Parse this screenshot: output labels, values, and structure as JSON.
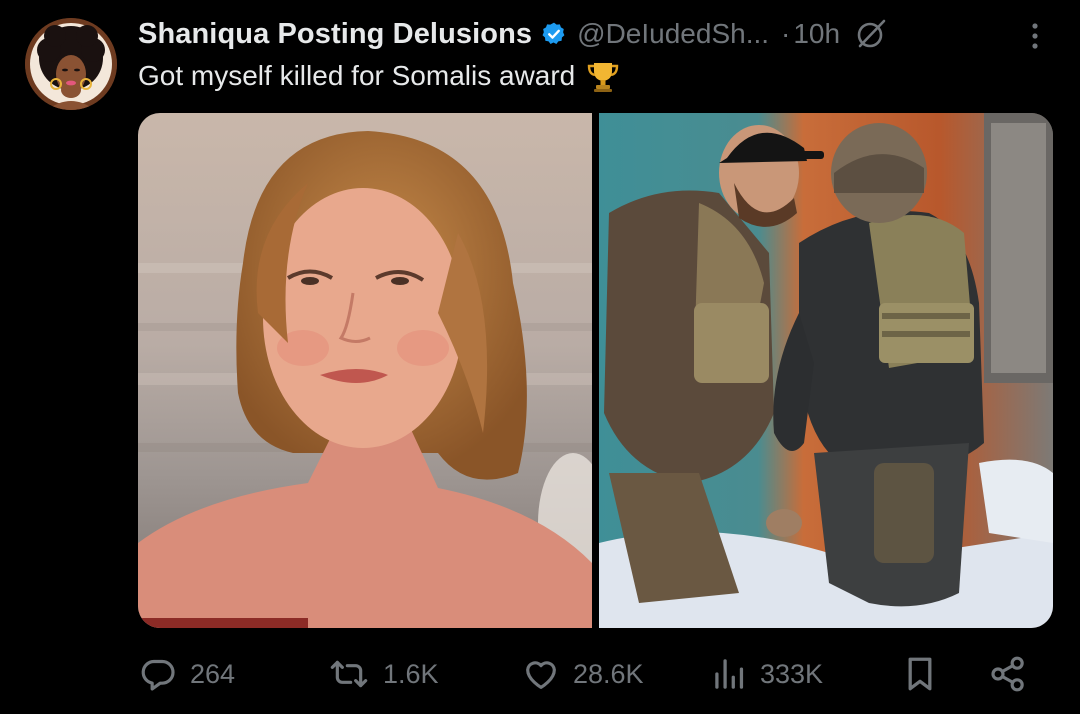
{
  "tweet": {
    "display_name": "Shaniqua Posting Delusions",
    "handle": "@DeIudedSh...",
    "separator": "·",
    "time": "10h",
    "text": "Got myself killed for Somalis award",
    "icons": {
      "verified": "verified-badge-icon",
      "grok": "grok-icon",
      "more": "more-options-icon",
      "trophy": "trophy-icon"
    }
  },
  "actions": {
    "reply": {
      "icon": "reply-icon",
      "count": "264"
    },
    "repost": {
      "icon": "repost-icon",
      "count": "1.6K"
    },
    "like": {
      "icon": "heart-icon",
      "count": "28.6K"
    },
    "views": {
      "icon": "views-icon",
      "count": "333K"
    },
    "bookmark": {
      "icon": "bookmark-icon"
    },
    "share": {
      "icon": "share-icon"
    }
  },
  "colors": {
    "background": "#000000",
    "primary_text": "#e7e9ea",
    "secondary_text": "#71767b",
    "verified_blue": "#1d9bf0"
  }
}
